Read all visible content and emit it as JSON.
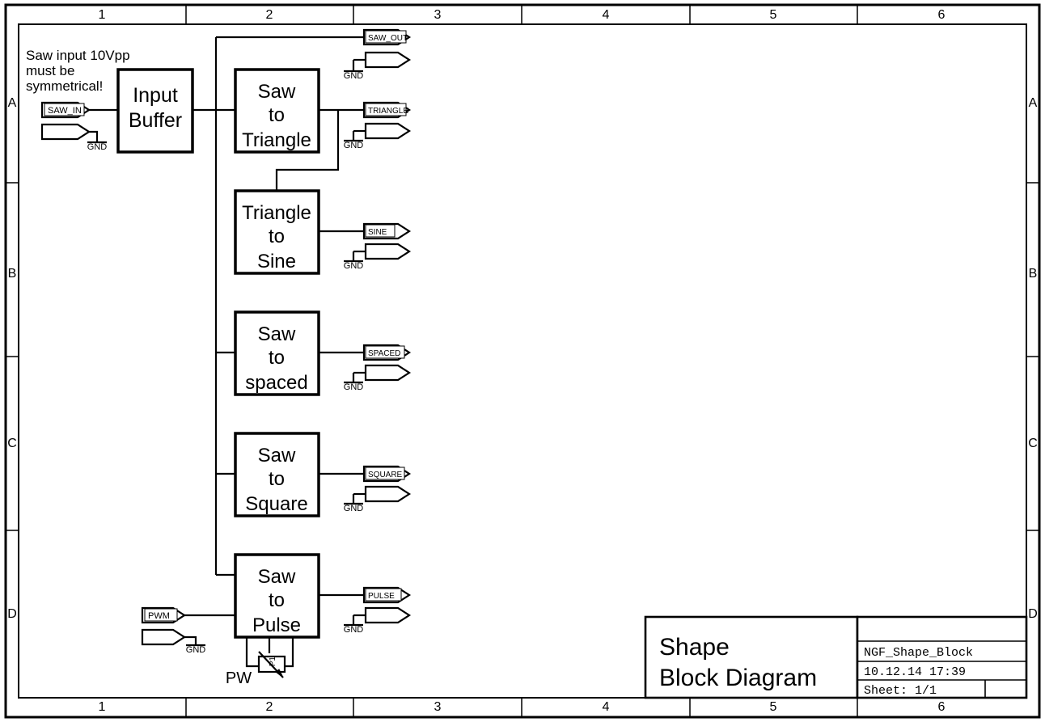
{
  "sheet": {
    "frame": {
      "columns": [
        "1",
        "2",
        "3",
        "4",
        "5",
        "6"
      ],
      "rows": [
        "A",
        "B",
        "C",
        "D"
      ]
    }
  },
  "notes": [
    {
      "id": "saw-input-note",
      "lines": [
        "Saw input 10Vpp",
        "must be",
        "symmetrical!"
      ]
    }
  ],
  "blocks": [
    {
      "id": "input-buffer",
      "lines": [
        "Input",
        "Buffer"
      ]
    },
    {
      "id": "saw-to-triangle",
      "lines": [
        "Saw",
        "to",
        "Triangle"
      ]
    },
    {
      "id": "triangle-to-sine",
      "lines": [
        "Triangle",
        "to",
        "Sine"
      ]
    },
    {
      "id": "saw-to-spaced",
      "lines": [
        "Saw",
        "to",
        "spaced"
      ]
    },
    {
      "id": "saw-to-square",
      "lines": [
        "Saw",
        "to",
        "Square"
      ]
    },
    {
      "id": "saw-to-pulse",
      "lines": [
        "Saw",
        "to",
        "Pulse"
      ]
    }
  ],
  "input_ports": [
    {
      "id": "saw-in",
      "label": "SAW_IN"
    },
    {
      "id": "pwm",
      "label": "PWM"
    }
  ],
  "output_ports": [
    {
      "id": "saw-out",
      "label": "SAW_OUT"
    },
    {
      "id": "triangle",
      "label": "TRIANGLE"
    },
    {
      "id": "sine",
      "label": "SINE"
    },
    {
      "id": "spaced",
      "label": "SPACED"
    },
    {
      "id": "square",
      "label": "SQUARE"
    },
    {
      "id": "pulse",
      "label": "PULSE"
    }
  ],
  "ground_labels": [
    {
      "id": "gnd-saw-in",
      "label": "GND"
    },
    {
      "id": "gnd-saw-out",
      "label": "GND"
    },
    {
      "id": "gnd-triangle",
      "label": "GND"
    },
    {
      "id": "gnd-sine",
      "label": "GND"
    },
    {
      "id": "gnd-spaced",
      "label": "GND"
    },
    {
      "id": "gnd-square",
      "label": "GND"
    },
    {
      "id": "gnd-pwm",
      "label": "GND"
    },
    {
      "id": "gnd-pulse",
      "label": "GND"
    }
  ],
  "components": [
    {
      "id": "pot-p1",
      "reference": "P1",
      "name": "PW"
    }
  ],
  "title_block": {
    "title_lines": [
      "Shape",
      "Block Diagram"
    ],
    "blank_row": "",
    "document_name": "NGF_Shape_Block",
    "date": "10.12.14 17:39",
    "sheet": "Sheet: 1/1",
    "revision": ""
  },
  "colors": {
    "line": "#000000",
    "background": "#ffffff"
  }
}
